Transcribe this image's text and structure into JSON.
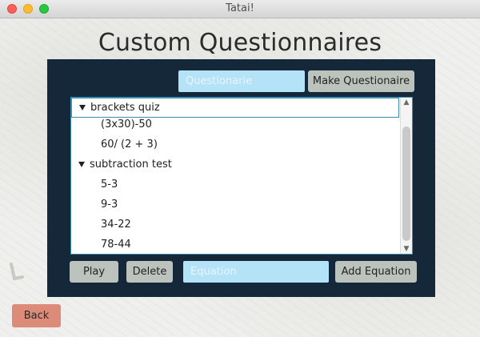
{
  "window": {
    "title": "Tatai!"
  },
  "header": {
    "title": "Custom Questionnaires"
  },
  "toolbar": {
    "questionnaire_placeholder": "Questionarie",
    "make_label": "Make Questionaire"
  },
  "tree": {
    "groups": [
      {
        "label": "brackets quiz",
        "items": [
          "(3x30)-50",
          "60/ (2 + 3)"
        ]
      },
      {
        "label": "subtraction test",
        "items": [
          "5-3",
          "9-3",
          "34-22",
          "78-44"
        ]
      }
    ]
  },
  "actions": {
    "play_label": "Play",
    "delete_label": "Delete",
    "equation_placeholder": "Equation",
    "add_label": "Add Equation"
  },
  "footer": {
    "back_label": "Back"
  },
  "colors": {
    "panel": "#15283a",
    "field": "#b4e2f6",
    "button": "#bcc3bd",
    "back_button": "#db8b78"
  }
}
